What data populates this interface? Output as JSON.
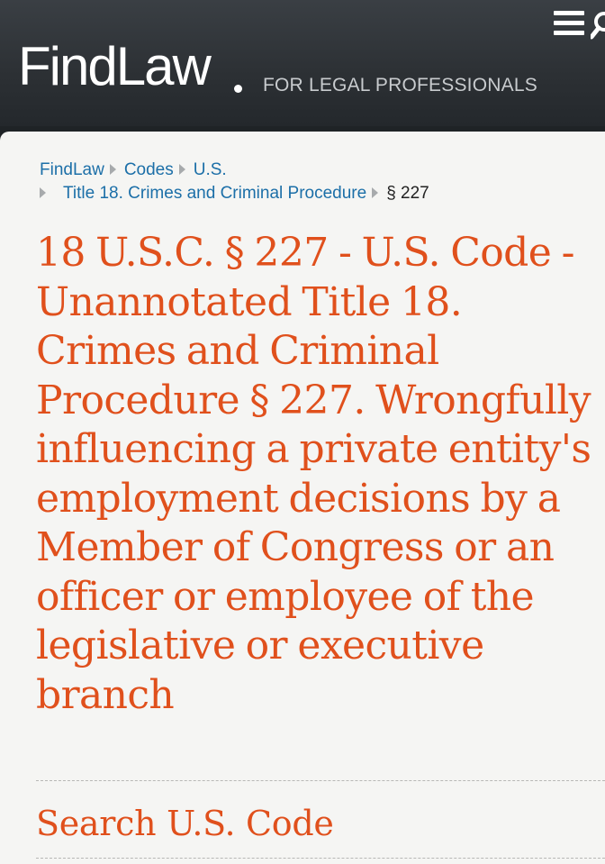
{
  "header": {
    "logo_text": "FindLaw",
    "tagline": "FOR LEGAL PROFESSIONALS",
    "icons": [
      "menu-icon",
      "search-icon"
    ],
    "background_color": "#2c3034"
  },
  "breadcrumb": {
    "items": [
      {
        "label": "FindLaw"
      },
      {
        "label": "Codes"
      },
      {
        "label": "U.S."
      },
      {
        "label": "Title 18. Crimes and Criminal Procedure"
      }
    ],
    "current": "§ 227"
  },
  "page": {
    "title": "18 U.S.C. § 227 - U.S. Code - Unannotated Title 18. Crimes and Criminal Procedure §  227. Wrongfully influencing a private entity's employment decisions by a Member of Congress or an officer or employee of the legislative or executive branch",
    "section_heading": "Search U.S. Code",
    "accent_color": "#e0501c",
    "link_color": "#1c6fa8"
  }
}
